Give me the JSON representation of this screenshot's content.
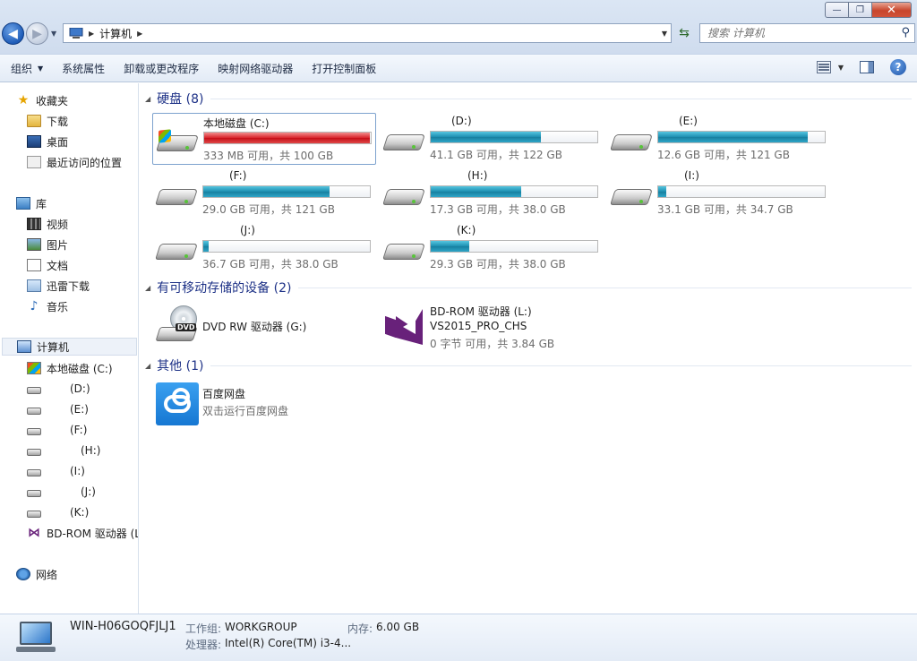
{
  "window": {
    "minimize_glyph": "—",
    "maximize_glyph": "❐",
    "close_glyph": "✕"
  },
  "nav": {
    "back_glyph": "◀",
    "forward_glyph": "▶",
    "breadcrumb": "计算机",
    "search_placeholder": "搜索 计算机",
    "search_icon": "magnifier-icon",
    "refresh_icon": "refresh-icon"
  },
  "toolbar": {
    "organize": "组织",
    "system_properties": "系统属性",
    "uninstall": "卸载或更改程序",
    "map_drive": "映射网络驱动器",
    "control_panel": "打开控制面板"
  },
  "sidebar": {
    "favorites": "收藏夹",
    "downloads": "下载",
    "desktop": "桌面",
    "recent": "最近访问的位置",
    "libraries": "库",
    "videos": "视频",
    "pictures": "图片",
    "documents": "文档",
    "thunder": "迅雷下载",
    "music": "音乐",
    "computer": "计算机",
    "drives": [
      "本地磁盘 (C:)",
      "(D:)",
      "(E:)",
      "(F:)",
      "(H:)",
      "(I:)",
      "(J:)",
      "(K:)",
      "BD-ROM 驱动器 (L"
    ],
    "network": "网络"
  },
  "groups": {
    "hdd": "硬盘 (8)",
    "removable": "有可移动存储的设备 (2)",
    "other": "其他 (1)"
  },
  "hdds": [
    {
      "label": "本地磁盘 (C:)",
      "info": "333 MB 可用，共 100 GB",
      "used": 0.997
    },
    {
      "label": "(D:)",
      "info": "41.1 GB 可用，共 122 GB",
      "used": 0.663
    },
    {
      "label": "(E:)",
      "info": "12.6 GB 可用，共 121 GB",
      "used": 0.896
    },
    {
      "label": "(F:)",
      "info": "29.0 GB 可用，共 121 GB",
      "used": 0.76
    },
    {
      "label": "(H:)",
      "info": "17.3 GB 可用，共 38.0 GB",
      "used": 0.545
    },
    {
      "label": "(I:)",
      "info": "33.1 GB 可用，共 34.7 GB",
      "used": 0.046
    },
    {
      "label": "(J:)",
      "info": "36.7 GB 可用，共 38.0 GB",
      "used": 0.034
    },
    {
      "label": "(K:)",
      "info": "29.3 GB 可用，共 38.0 GB",
      "used": 0.229
    }
  ],
  "removable": {
    "dvd": {
      "label": "DVD RW 驱动器 (G:)",
      "tag": "DVD"
    },
    "bd": {
      "label": "BD-ROM 驱动器 (L:)",
      "volume": "VS2015_PRO_CHS",
      "info": "0 字节 可用，共 3.84 GB"
    }
  },
  "other": {
    "baidu": {
      "label": "百度网盘",
      "desc": "双击运行百度网盘"
    }
  },
  "details": {
    "name": "WIN-H06GOQFJLJ1",
    "workgroup_label": "工作组:",
    "workgroup": "WORKGROUP",
    "memory_label": "内存:",
    "memory": "6.00 GB",
    "cpu_label": "处理器:",
    "cpu": "Intel(R) Core(TM) i3-4..."
  }
}
